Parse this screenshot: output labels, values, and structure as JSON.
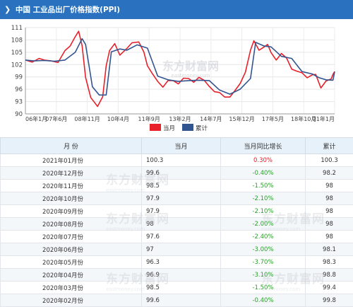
{
  "header": {
    "title": "中国  工业品出厂价格指数(PPI)"
  },
  "watermark": {
    "text": "东方财富网",
    "sub": "eastmoney.com"
  },
  "colors": {
    "current": "#e8202a",
    "cumulative": "#33558f",
    "header_bg": "#2a72c0"
  },
  "chart_data": {
    "type": "line",
    "ylim": [
      90,
      111
    ],
    "yticks": [
      90,
      93,
      96,
      99,
      102,
      105,
      108,
      111
    ],
    "x_tick_labels": [
      "06年1月",
      "07年6月",
      "08年11月",
      "10年4月",
      "11年9月",
      "13年2月",
      "14年7月",
      "15年12月",
      "17年5月",
      "18年10月",
      "21年1月"
    ],
    "x_range": [
      "2006-01",
      "2021-01"
    ],
    "grid": true,
    "legend": [
      "当月",
      "累计"
    ],
    "series": [
      {
        "name": "当月",
        "points": [
          [
            "2006-01",
            103.1
          ],
          [
            "2006-05",
            102.6
          ],
          [
            "2006-09",
            103.5
          ],
          [
            "2006-12",
            103.1
          ],
          [
            "2007-04",
            102.9
          ],
          [
            "2007-08",
            102.5
          ],
          [
            "2007-12",
            105.4
          ],
          [
            "2008-03",
            106.5
          ],
          [
            "2008-06",
            108.8
          ],
          [
            "2008-08",
            110.1
          ],
          [
            "2008-10",
            106.6
          ],
          [
            "2008-12",
            98.9
          ],
          [
            "2009-03",
            94.0
          ],
          [
            "2009-07",
            91.8
          ],
          [
            "2009-10",
            94.2
          ],
          [
            "2009-12",
            101.7
          ],
          [
            "2010-02",
            105.4
          ],
          [
            "2010-05",
            107.1
          ],
          [
            "2010-08",
            104.3
          ],
          [
            "2010-12",
            105.9
          ],
          [
            "2011-03",
            107.3
          ],
          [
            "2011-07",
            107.5
          ],
          [
            "2011-10",
            105.0
          ],
          [
            "2011-12",
            101.7
          ],
          [
            "2012-03",
            99.7
          ],
          [
            "2012-06",
            97.9
          ],
          [
            "2012-09",
            96.5
          ],
          [
            "2012-12",
            98.1
          ],
          [
            "2013-03",
            98.1
          ],
          [
            "2013-06",
            97.3
          ],
          [
            "2013-09",
            98.7
          ],
          [
            "2013-12",
            98.6
          ],
          [
            "2014-03",
            97.7
          ],
          [
            "2014-06",
            98.9
          ],
          [
            "2014-09",
            98.2
          ],
          [
            "2014-12",
            96.7
          ],
          [
            "2015-03",
            95.4
          ],
          [
            "2015-06",
            95.2
          ],
          [
            "2015-09",
            94.1
          ],
          [
            "2015-12",
            94.1
          ],
          [
            "2016-03",
            95.7
          ],
          [
            "2016-06",
            97.4
          ],
          [
            "2016-09",
            100.1
          ],
          [
            "2016-12",
            105.5
          ],
          [
            "2017-02",
            107.8
          ],
          [
            "2017-05",
            105.5
          ],
          [
            "2017-08",
            106.3
          ],
          [
            "2017-10",
            106.9
          ],
          [
            "2017-12",
            104.9
          ],
          [
            "2018-03",
            103.1
          ],
          [
            "2018-06",
            104.7
          ],
          [
            "2018-09",
            103.6
          ],
          [
            "2018-12",
            100.9
          ],
          [
            "2019-03",
            100.4
          ],
          [
            "2019-06",
            100.0
          ],
          [
            "2019-09",
            98.8
          ],
          [
            "2019-12",
            99.5
          ],
          [
            "2020-02",
            99.6
          ],
          [
            "2020-05",
            96.3
          ],
          [
            "2020-08",
            98.0
          ],
          [
            "2020-11",
            98.5
          ],
          [
            "2020-12",
            99.6
          ],
          [
            "2021-01",
            100.3
          ]
        ]
      },
      {
        "name": "累计",
        "points": [
          [
            "2006-01",
            103.1
          ],
          [
            "2006-06",
            102.9
          ],
          [
            "2006-12",
            103.0
          ],
          [
            "2007-06",
            102.8
          ],
          [
            "2007-12",
            103.1
          ],
          [
            "2008-06",
            105.0
          ],
          [
            "2008-10",
            108.3
          ],
          [
            "2008-12",
            106.9
          ],
          [
            "2009-04",
            96.6
          ],
          [
            "2009-08",
            94.6
          ],
          [
            "2009-12",
            94.6
          ],
          [
            "2010-03",
            105.1
          ],
          [
            "2010-08",
            105.8
          ],
          [
            "2010-12",
            105.5
          ],
          [
            "2011-06",
            106.8
          ],
          [
            "2011-12",
            106.0
          ],
          [
            "2012-06",
            99.2
          ],
          [
            "2012-12",
            98.3
          ],
          [
            "2013-06",
            97.9
          ],
          [
            "2013-12",
            98.1
          ],
          [
            "2014-06",
            98.2
          ],
          [
            "2014-12",
            98.1
          ],
          [
            "2015-06",
            95.8
          ],
          [
            "2015-12",
            94.8
          ],
          [
            "2016-06",
            96.0
          ],
          [
            "2016-12",
            98.6
          ],
          [
            "2017-03",
            107.4
          ],
          [
            "2017-08",
            106.5
          ],
          [
            "2017-12",
            106.3
          ],
          [
            "2018-06",
            104.0
          ],
          [
            "2018-12",
            103.5
          ],
          [
            "2019-06",
            100.3
          ],
          [
            "2019-12",
            99.7
          ],
          [
            "2020-04",
            98.8
          ],
          [
            "2020-08",
            98.3
          ],
          [
            "2020-12",
            98.2
          ],
          [
            "2021-01",
            100.3
          ]
        ]
      }
    ]
  },
  "table": {
    "headers": [
      "月    份",
      "当月",
      "当月同比增长",
      "累计"
    ],
    "rows": [
      {
        "month": "2021年01月份",
        "current": "100.3",
        "yoy": "0.30%",
        "yoy_sign": "pos",
        "cumulative": "100.3"
      },
      {
        "month": "2020年12月份",
        "current": "99.6",
        "yoy": "-0.40%",
        "yoy_sign": "neg",
        "cumulative": "98.2"
      },
      {
        "month": "2020年11月份",
        "current": "98.5",
        "yoy": "-1.50%",
        "yoy_sign": "neg",
        "cumulative": "98"
      },
      {
        "month": "2020年10月份",
        "current": "97.9",
        "yoy": "-2.10%",
        "yoy_sign": "neg",
        "cumulative": "98"
      },
      {
        "month": "2020年09月份",
        "current": "97.9",
        "yoy": "-2.10%",
        "yoy_sign": "neg",
        "cumulative": "98"
      },
      {
        "month": "2020年08月份",
        "current": "98",
        "yoy": "-2.00%",
        "yoy_sign": "neg",
        "cumulative": "98"
      },
      {
        "month": "2020年07月份",
        "current": "97.6",
        "yoy": "-2.40%",
        "yoy_sign": "neg",
        "cumulative": "98"
      },
      {
        "month": "2020年06月份",
        "current": "97",
        "yoy": "-3.00%",
        "yoy_sign": "neg",
        "cumulative": "98.1"
      },
      {
        "month": "2020年05月份",
        "current": "96.3",
        "yoy": "-3.70%",
        "yoy_sign": "neg",
        "cumulative": "98.3"
      },
      {
        "month": "2020年04月份",
        "current": "96.9",
        "yoy": "-3.10%",
        "yoy_sign": "neg",
        "cumulative": "98.8"
      },
      {
        "month": "2020年03月份",
        "current": "98.5",
        "yoy": "-1.50%",
        "yoy_sign": "neg",
        "cumulative": "99.4"
      },
      {
        "month": "2020年02月份",
        "current": "99.6",
        "yoy": "-0.40%",
        "yoy_sign": "neg",
        "cumulative": "99.8"
      }
    ]
  }
}
